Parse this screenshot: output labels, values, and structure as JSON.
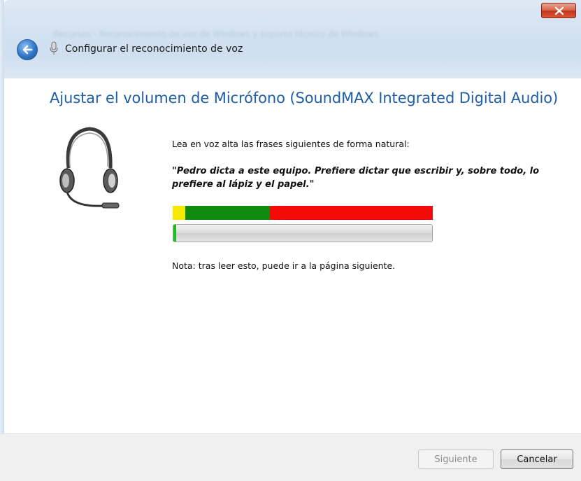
{
  "window": {
    "blurred_background_title": "Recursos - Reconocimiento de voz de Windows y soporte técnico de Windows",
    "title": "Configurar el reconocimiento de voz"
  },
  "main": {
    "heading": "Ajustar el volumen de Micrófono (SoundMAX Integrated Digital Audio)",
    "instruction": "Lea en voz alta las frases siguientes de forma natural:",
    "quote": "\"Pedro dicta a este equipo. Prefiere dictar que escribir y, sobre todo, lo prefiere al lápiz y el papel.\"",
    "level_meter": {
      "colors": {
        "low": "#f6e800",
        "good": "#0e8a0e",
        "high": "#f50a0a"
      }
    },
    "volume_level": 0.01,
    "note": "Nota: tras leer esto, puede ir a la página siguiente."
  },
  "footer": {
    "next_label": "Siguiente",
    "cancel_label": "Cancelar"
  },
  "icons": [
    "back-arrow-icon",
    "microphone-icon",
    "close-icon",
    "headset-icon"
  ]
}
